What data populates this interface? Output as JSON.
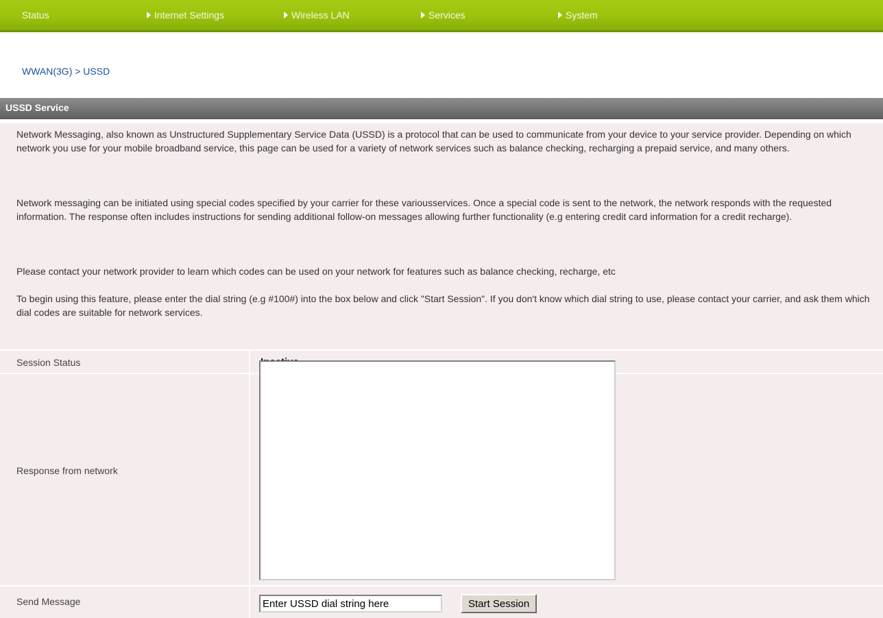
{
  "nav": {
    "items": [
      {
        "label": "Status",
        "has_arrow": false
      },
      {
        "label": "Internet Settings",
        "has_arrow": true
      },
      {
        "label": "Wireless LAN",
        "has_arrow": true
      },
      {
        "label": "Services",
        "has_arrow": true
      },
      {
        "label": "System",
        "has_arrow": true
      }
    ]
  },
  "breadcrumb": "WWAN(3G) > USSD",
  "section": {
    "title": "USSD Service",
    "paragraphs": [
      "Network Messaging, also known as Unstructured Supplementary Service Data (USSD) is a protocol that can be used to communicate from your device to your service provider. Depending on which network you use for your mobile broadband service, this page can be used for a variety of network services such as balance checking, recharging a prepaid service, and many others.",
      "Network messaging can be initiated using special codes specified by your carrier for these variousservices. Once a special code is sent to the network, the network responds with the requested information. The response often includes instructions for sending additional follow-on messages allowing further functionality (e.g entering credit card information for a credit recharge).",
      "Please contact your network provider to learn which codes can be used on your network for features such as balance checking, recharge, etc",
      "To begin using this feature, please enter the dial string (e.g #100#) into the box below and click \"Start Session\". If you don't know which dial string to use, please contact your carrier, and ask them which dial codes are suitable for network services."
    ]
  },
  "form": {
    "session_status_label": "Session Status",
    "session_status_value": "Inactive",
    "response_label": "Response from network",
    "response_value": "",
    "send_label": "Send Message",
    "dial_input_value": "Enter USSD dial string here",
    "start_button": "Start Session"
  },
  "colors": {
    "nav_green": "#9cc30d",
    "header_gray": "#777777",
    "panel_pink": "#f5ecee",
    "breadcrumb_blue": "#1a4e9e"
  }
}
